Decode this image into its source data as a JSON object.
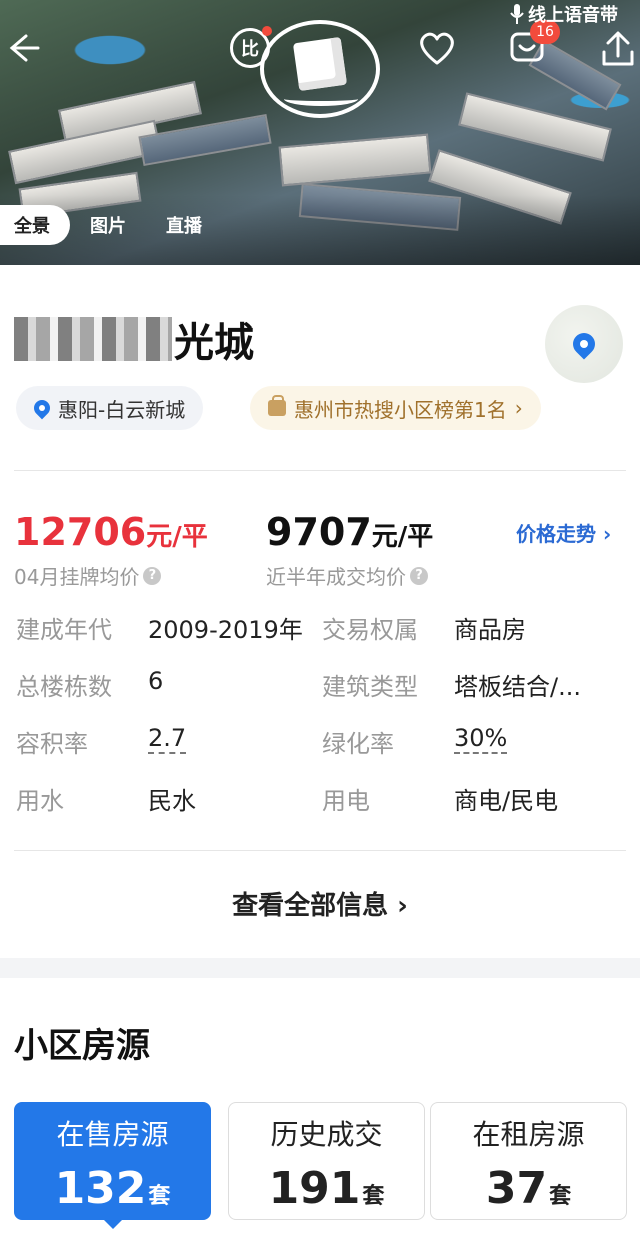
{
  "header": {
    "voice_label": "线上语音带",
    "compare_label": "比",
    "share_badge": "16",
    "icons": [
      "back-arrow-icon",
      "compare-icon",
      "3d-cube-icon",
      "heart-icon",
      "message-icon",
      "share-icon",
      "mic-icon"
    ]
  },
  "media_tabs": [
    {
      "label": "全景",
      "active": true
    },
    {
      "label": "图片",
      "active": false
    },
    {
      "label": "直播",
      "active": false
    }
  ],
  "community": {
    "name_visible": "光城",
    "location": "惠阳-白云新城",
    "rank": "惠州市热搜小区榜第1名",
    "rank_arrow": "›"
  },
  "prices": {
    "listing_value": "12706",
    "listing_unit": "元/平",
    "listing_label": "04月挂牌均价",
    "deal_value": "9707",
    "deal_unit": "元/平",
    "deal_label": "近半年成交均价",
    "trend_link": "价格走势 ›"
  },
  "attributes": [
    {
      "key": "建成年代",
      "value": "2009-2019年"
    },
    {
      "key": "交易权属",
      "value": "商品房"
    },
    {
      "key": "总楼栋数",
      "value": "6"
    },
    {
      "key": "建筑类型",
      "value": "塔板结合/..."
    },
    {
      "key": "容积率",
      "value": "2.7"
    },
    {
      "key": "绿化率",
      "value": "30%"
    },
    {
      "key": "用水",
      "value": "民水"
    },
    {
      "key": "用电",
      "value": "商电/民电"
    }
  ],
  "more_info": "查看全部信息 ›",
  "listings": {
    "title": "小区房源",
    "unit": "套",
    "tiles": [
      {
        "label": "在售房源",
        "count": "132",
        "active": true
      },
      {
        "label": "历史成交",
        "count": "191",
        "active": false
      },
      {
        "label": "在租房源",
        "count": "37",
        "active": false
      }
    ]
  },
  "colors": {
    "accent": "#2378e8",
    "price_red": "#e8323c",
    "rank_gold": "#a0712c"
  }
}
